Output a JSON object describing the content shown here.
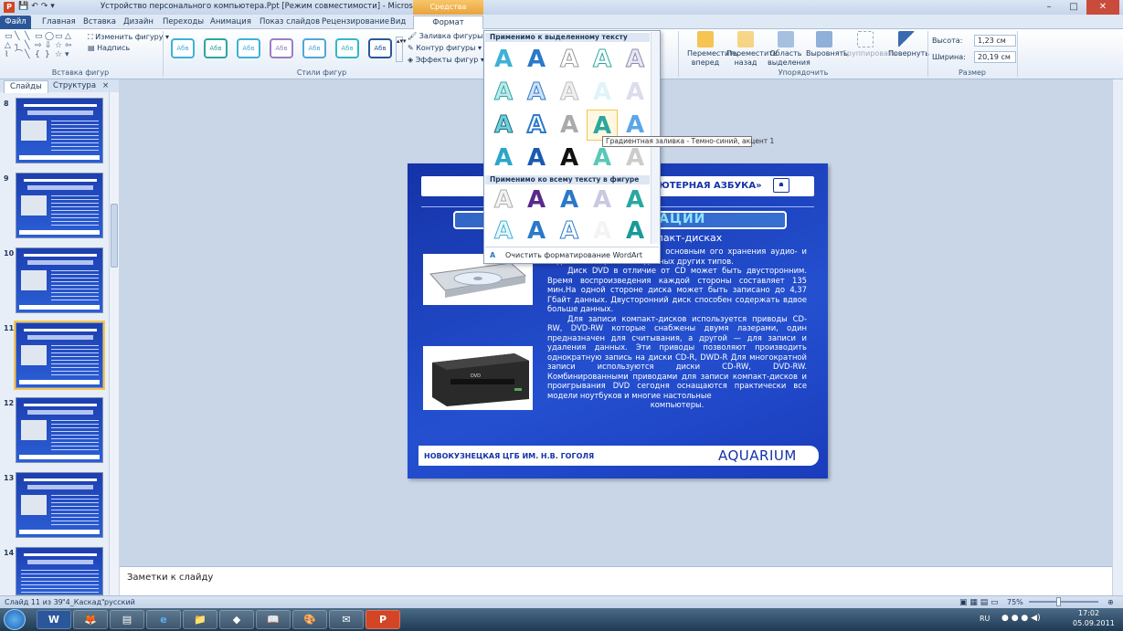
{
  "window": {
    "title": "Устройство персонального компьютера.Ppt [Режим совместимости] - Microsoft PowerPoint",
    "context_group": "Средства рисования",
    "minimize": "–",
    "maximize": "□",
    "close": "✕"
  },
  "tabs": [
    "Файл",
    "Главная",
    "Вставка",
    "Дизайн",
    "Переходы",
    "Анимация",
    "Показ слайдов",
    "Рецензирование",
    "Вид",
    "Формат"
  ],
  "ribbon": {
    "insert_shapes_group": "Вставка фигур",
    "edit_shape": "Изменить фигуру",
    "text_box": "Надпись",
    "shape_styles_group": "Стили фигур",
    "style_sample": "Абв",
    "shape_fill": "Заливка фигуры",
    "shape_outline": "Контур фигуры",
    "shape_effects": "Эффекты фигур",
    "bring_forward": "Переместить вперед",
    "send_backward": "Переместить назад",
    "selection_pane": "Область выделения",
    "align": "Выровнять",
    "group": "Группировать",
    "rotate": "Повернуть",
    "arrange_group": "Упорядочить",
    "height_label": "Высота:",
    "height_value": "1,23 см",
    "width_label": "Ширина:",
    "width_value": "20,19 см",
    "size_group": "Размер"
  },
  "left_panel": {
    "tab_slides": "Слайды",
    "tab_outline": "Структура",
    "close": "×",
    "slide_numbers": [
      "8",
      "9",
      "10",
      "11",
      "12",
      "13",
      "14"
    ],
    "selected": "11"
  },
  "slide": {
    "header_text": "ЮТЕРНАЯ АЗБУКА»",
    "title": "УСТ                              Я ИНФОРМАЦИИ",
    "subtitle": "а компакт-дисках",
    "body_p1": "R) пожалуй, являются основным   ого хранения аудио- и видеозаписей, а также данных других типов.",
    "body_p2": "Диск DVD в отличие от CD может быть двусторонним. Время воспроизведения каждой стороны составляет 135 мин.На одной стороне диска может быть записано до 4,37 Гбайт данных. Двусторонний диск способен содержать вдвое больше данных.",
    "body_p3": "Для записи компакт-дисков используется приводы CD-RW, DVD-RW которые снабжены двумя лазерами, один предназначен для считывания, а другой — для записи и удаления данных. Эти приводы позволяют производить однократную запись на диски CD-R, DWD-R Для многократной записи используются диски CD-RW, DVD-RW. Комбинированными приводами для записи компакт-дисков и проигрывания DVD сегодня оснащаются практически все модели ноутбуков и многие настольные",
    "body_p4": "компьютеры.",
    "footer_text": "НОВОКУЗНЕЦКАЯ  ЦГБ ИМ. Н.В. ГОГОЛЯ",
    "brand": "AQUARIUM"
  },
  "gallery": {
    "section1": "Применимо к выделенному тексту",
    "section2": "Применимо ко всему тексту в фигуре",
    "glyph": "A",
    "clear": "Очистить форматирование WordArt",
    "tooltip": "Градиентная заливка - Темно-синий, акцент 1"
  },
  "notes_placeholder": "Заметки к слайду",
  "status": {
    "slide_info": "Слайд 11 из 39",
    "theme": "\"4_Каскад\"",
    "language": "русский",
    "zoom": "75%"
  },
  "tray": {
    "lang": "RU",
    "time": "17:02",
    "date": "05.09.2011"
  },
  "colors": {
    "accent": "#2b579a",
    "slide_bg": "#1d3fb0",
    "context_tab": "#eaa23a"
  }
}
